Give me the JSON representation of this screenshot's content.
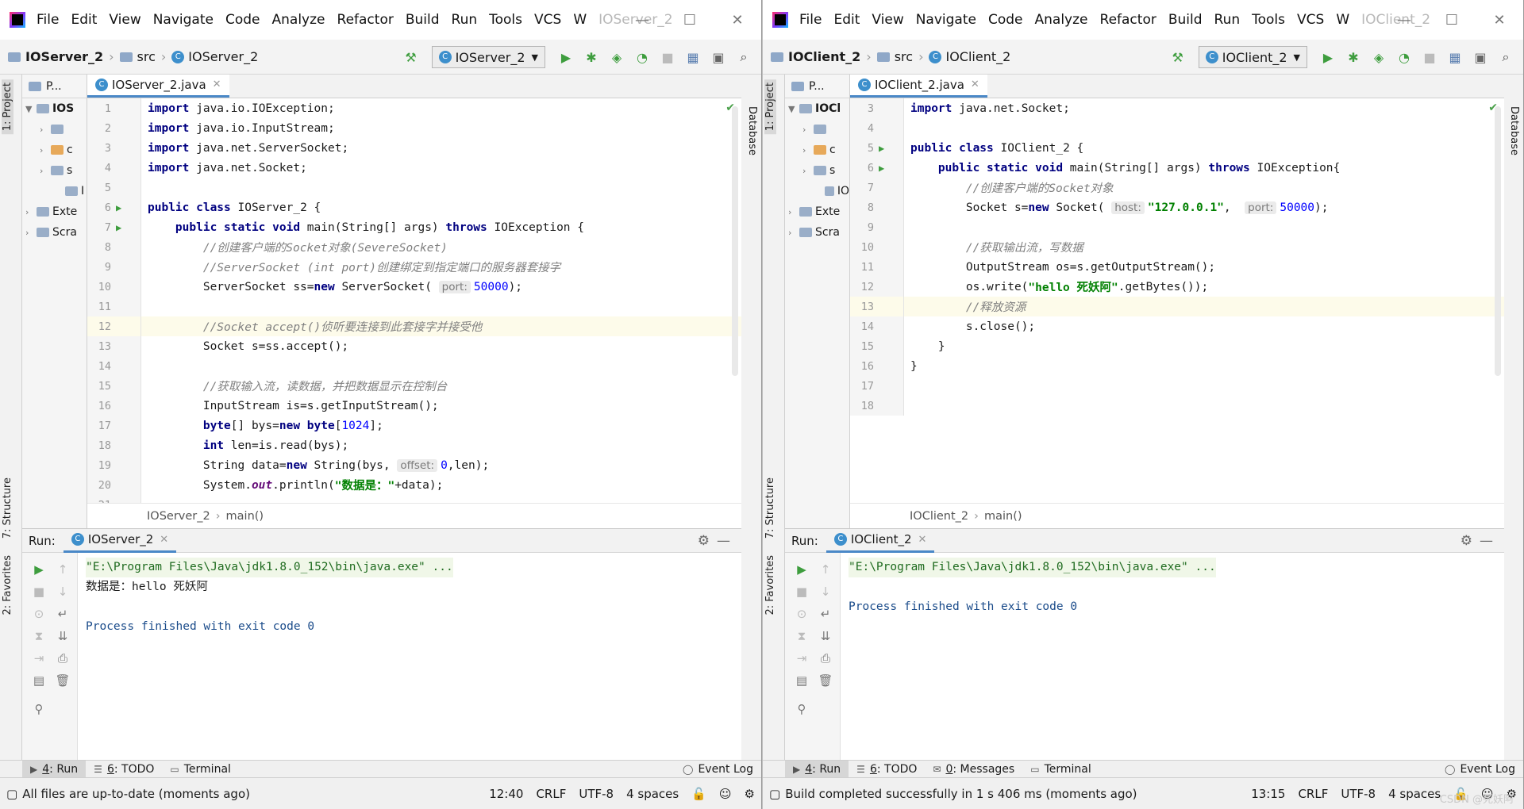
{
  "menu": [
    "File",
    "Edit",
    "View",
    "Navigate",
    "Code",
    "Analyze",
    "Refactor",
    "Build",
    "Run",
    "Tools",
    "VCS",
    "W"
  ],
  "left": {
    "title": "IOServer_2",
    "crumb": {
      "project": "IOServer_2",
      "src": "src",
      "cls": "IOServer_2"
    },
    "run_config": "IOServer_2",
    "project_tab": "P...",
    "tree": [
      "IOS",
      "",
      "c",
      "s",
      "I",
      "Exte",
      "Scra"
    ],
    "file_tab": "IOServer_2.java",
    "code_breadcrumb": {
      "cls": "IOServer_2",
      "method": "main()"
    },
    "lines": [
      {
        "n": "1",
        "p": [
          [
            "k",
            "import"
          ],
          [
            "t",
            " java.io.IOException;"
          ]
        ]
      },
      {
        "n": "2",
        "p": [
          [
            "k",
            "import"
          ],
          [
            "t",
            " java.io.InputStream;"
          ]
        ]
      },
      {
        "n": "3",
        "p": [
          [
            "k",
            "import"
          ],
          [
            "t",
            " java.net.ServerSocket;"
          ]
        ]
      },
      {
        "n": "4",
        "p": [
          [
            "k",
            "import"
          ],
          [
            "t",
            " java.net.Socket;"
          ]
        ]
      },
      {
        "n": "5",
        "p": []
      },
      {
        "n": "6",
        "run": true,
        "p": [
          [
            "k",
            "public class"
          ],
          [
            "t",
            " IOServer_2 {"
          ]
        ]
      },
      {
        "n": "7",
        "run": true,
        "p": [
          [
            "t",
            "    "
          ],
          [
            "k",
            "public static void"
          ],
          [
            "t",
            " main(String[] args) "
          ],
          [
            "k",
            "throws"
          ],
          [
            "t",
            " IOException {"
          ]
        ]
      },
      {
        "n": "8",
        "p": [
          [
            "t",
            "        "
          ],
          [
            "c",
            "//创建客户端的Socket对象(SevereSocket)"
          ]
        ]
      },
      {
        "n": "9",
        "p": [
          [
            "t",
            "        "
          ],
          [
            "c",
            "//ServerSocket (int port)创建绑定到指定端口的服务器套接字"
          ]
        ]
      },
      {
        "n": "10",
        "p": [
          [
            "t",
            "        ServerSocket ss="
          ],
          [
            "k",
            "new"
          ],
          [
            "t",
            " ServerSocket( "
          ],
          [
            "h",
            "port:"
          ],
          [
            "n",
            "50000"
          ],
          [
            "t",
            ");"
          ]
        ]
      },
      {
        "n": "11",
        "p": []
      },
      {
        "n": "12",
        "hl": true,
        "p": [
          [
            "t",
            "        "
          ],
          [
            "c",
            "//Socket accept()侦听要连接到此套接字并接受他"
          ]
        ]
      },
      {
        "n": "13",
        "p": [
          [
            "t",
            "        Socket s=ss.accept();"
          ]
        ]
      },
      {
        "n": "14",
        "p": []
      },
      {
        "n": "15",
        "p": [
          [
            "t",
            "        "
          ],
          [
            "c",
            "//获取输入流，读数据，并把数据显示在控制台"
          ]
        ]
      },
      {
        "n": "16",
        "p": [
          [
            "t",
            "        InputStream is=s.getInputStream();"
          ]
        ]
      },
      {
        "n": "17",
        "p": [
          [
            "t",
            "        "
          ],
          [
            "k",
            "byte"
          ],
          [
            "t",
            "[] bys="
          ],
          [
            "k",
            "new byte"
          ],
          [
            "t",
            "["
          ],
          [
            "n",
            "1024"
          ],
          [
            "t",
            "];"
          ]
        ]
      },
      {
        "n": "18",
        "p": [
          [
            "t",
            "        "
          ],
          [
            "k",
            "int"
          ],
          [
            "t",
            " len=is.read(bys);"
          ]
        ]
      },
      {
        "n": "19",
        "p": [
          [
            "t",
            "        String data="
          ],
          [
            "k",
            "new"
          ],
          [
            "t",
            " String(bys, "
          ],
          [
            "h",
            "offset:"
          ],
          [
            "n",
            "0"
          ],
          [
            "t",
            ",len);"
          ]
        ]
      },
      {
        "n": "20",
        "p": [
          [
            "t",
            "        System."
          ],
          [
            "f",
            "out"
          ],
          [
            "t",
            ".println("
          ],
          [
            "s",
            "\"数据是：\""
          ],
          [
            "t",
            "+data);"
          ]
        ]
      },
      {
        "n": "21",
        "p": []
      }
    ],
    "run_tab": "IOServer_2",
    "run_output": [
      {
        "cls": "cmd",
        "text": "\"E:\\Program Files\\Java\\jdk1.8.0_152\\bin\\java.exe\" ..."
      },
      {
        "cls": "out",
        "text": "数据是：hello 死妖阿"
      },
      {
        "cls": "",
        "text": ""
      },
      {
        "cls": "fin",
        "text": "Process finished with exit code 0"
      }
    ],
    "bottom_tabs": [
      {
        "num": "4",
        "label": ": Run",
        "icon": "▶",
        "active": true
      },
      {
        "num": "6",
        "label": ": TODO",
        "icon": "☰"
      },
      {
        "num": "",
        "label": "Terminal",
        "icon": "▭"
      }
    ],
    "event_log": "Event Log",
    "status": {
      "msg": "All files are up-to-date (moments ago)",
      "pos": "12:40",
      "sep": "CRLF",
      "enc": "UTF-8",
      "indent": "4 spaces"
    }
  },
  "right": {
    "title": "IOClient_2",
    "crumb": {
      "project": "IOClient_2",
      "src": "src",
      "cls": "IOClient_2"
    },
    "run_config": "IOClient_2",
    "project_tab": "P...",
    "tree": [
      "IOCl",
      "",
      "c",
      "s",
      "IO",
      "Exte",
      "Scra"
    ],
    "file_tab": "IOClient_2.java",
    "code_breadcrumb": {
      "cls": "IOClient_2",
      "method": "main()"
    },
    "lines": [
      {
        "n": "3",
        "p": [
          [
            "k",
            "import"
          ],
          [
            "t",
            " java.net.Socket;"
          ]
        ]
      },
      {
        "n": "4",
        "p": []
      },
      {
        "n": "5",
        "run": true,
        "p": [
          [
            "k",
            "public class"
          ],
          [
            "t",
            " IOClient_2 {"
          ]
        ]
      },
      {
        "n": "6",
        "run": true,
        "p": [
          [
            "t",
            "    "
          ],
          [
            "k",
            "public static void"
          ],
          [
            "t",
            " main(String[] args) "
          ],
          [
            "k",
            "throws"
          ],
          [
            "t",
            " IOException{"
          ]
        ]
      },
      {
        "n": "7",
        "p": [
          [
            "t",
            "        "
          ],
          [
            "c",
            "//创建客户端的Socket对象"
          ]
        ]
      },
      {
        "n": "8",
        "p": [
          [
            "t",
            "        Socket s="
          ],
          [
            "k",
            "new"
          ],
          [
            "t",
            " Socket( "
          ],
          [
            "h",
            "host:"
          ],
          [
            "s",
            "\"127.0.0.1\""
          ],
          [
            "t",
            ",  "
          ],
          [
            "h",
            "port:"
          ],
          [
            "n",
            "50000"
          ],
          [
            "t",
            ");"
          ]
        ]
      },
      {
        "n": "9",
        "p": []
      },
      {
        "n": "10",
        "p": [
          [
            "t",
            "        "
          ],
          [
            "c",
            "//获取输出流，写数据"
          ]
        ]
      },
      {
        "n": "11",
        "p": [
          [
            "t",
            "        OutputStream os=s.getOutputStream();"
          ]
        ]
      },
      {
        "n": "12",
        "p": [
          [
            "t",
            "        os.write("
          ],
          [
            "s",
            "\"hello 死妖阿\""
          ],
          [
            "t",
            ".getBytes());"
          ]
        ]
      },
      {
        "n": "13",
        "hl": true,
        "p": [
          [
            "t",
            "        "
          ],
          [
            "c",
            "//释放资源"
          ]
        ]
      },
      {
        "n": "14",
        "p": [
          [
            "t",
            "        s.close();"
          ]
        ]
      },
      {
        "n": "15",
        "p": [
          [
            "t",
            "    }"
          ]
        ]
      },
      {
        "n": "16",
        "p": [
          [
            "t",
            "}"
          ]
        ]
      },
      {
        "n": "17",
        "p": []
      },
      {
        "n": "18",
        "p": []
      }
    ],
    "run_tab": "IOClient_2",
    "run_output": [
      {
        "cls": "cmd",
        "text": "\"E:\\Program Files\\Java\\jdk1.8.0_152\\bin\\java.exe\" ..."
      },
      {
        "cls": "",
        "text": ""
      },
      {
        "cls": "fin",
        "text": "Process finished with exit code 0"
      }
    ],
    "bottom_tabs": [
      {
        "num": "4",
        "label": ": Run",
        "icon": "▶",
        "active": true
      },
      {
        "num": "6",
        "label": ": TODO",
        "icon": "☰"
      },
      {
        "num": "0",
        "label": ": Messages",
        "icon": "✉"
      },
      {
        "num": "",
        "label": "Terminal",
        "icon": "▭"
      }
    ],
    "event_log": "Event Log",
    "status": {
      "msg": "Build completed successfully in 1 s 406 ms (moments ago)",
      "pos": "13:15",
      "sep": "CRLF",
      "enc": "UTF-8",
      "indent": "4 spaces"
    },
    "watermark": "CSDN @死妖阿"
  },
  "labels": {
    "run": "Run:",
    "side_project": "1: Project",
    "side_structure": "7: Structure",
    "side_favorites": "2: Favorites",
    "side_database": "Database"
  }
}
